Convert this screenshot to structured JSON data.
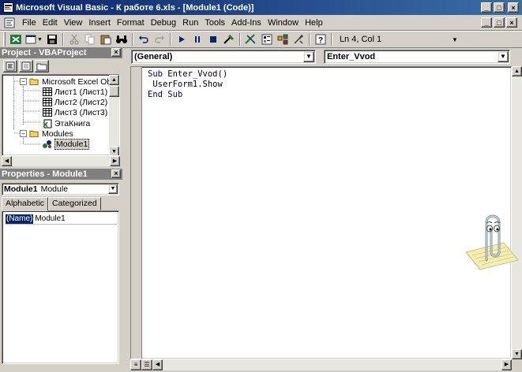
{
  "window": {
    "title": "Microsoft Visual Basic - К работе 6.xls - [Module1 (Code)]",
    "minimize_glyph": "_",
    "maximize_glyph": "□",
    "close_glyph": "×"
  },
  "menubar": {
    "items": [
      "File",
      "Edit",
      "View",
      "Insert",
      "Format",
      "Debug",
      "Run",
      "Tools",
      "Add-Ins",
      "Window",
      "Help"
    ]
  },
  "toolbar": {
    "status": "Ln 4, Col 1"
  },
  "project_pane": {
    "title": "Project - VBAProject",
    "tree": {
      "root_label": "Microsoft Excel Objec",
      "sheets": [
        "Лист1 (Лист1)",
        "Лист2 (Лист2)",
        "Лист3 (Лист3)"
      ],
      "workbook": "ЭтаКнига",
      "modules_label": "Modules",
      "module": "Module1"
    }
  },
  "properties_pane": {
    "title": "Properties - Module1",
    "object_name": "Module1",
    "object_type": "Module",
    "tabs": [
      "Alphabetic",
      "Categorized"
    ],
    "property_name": "(Name)",
    "property_value": "Module1"
  },
  "code_window": {
    "object_combo": "(General)",
    "procedure_combo": "Enter_Vvod",
    "code": {
      "line1_kw": "Sub",
      "line1_rest": " Enter_Vvod()",
      "line2": " UserForm1.Show",
      "line3_kw": "End Sub"
    }
  },
  "colors": {
    "title_gradient_start": "#0a246a",
    "title_gradient_end": "#3a6ea5",
    "pane_header": "#808080",
    "face": "#d4d0c8",
    "keyword": "#00007f"
  },
  "icons": {
    "app": "vba-app-icon",
    "assistant": "clippy-office-assistant"
  }
}
